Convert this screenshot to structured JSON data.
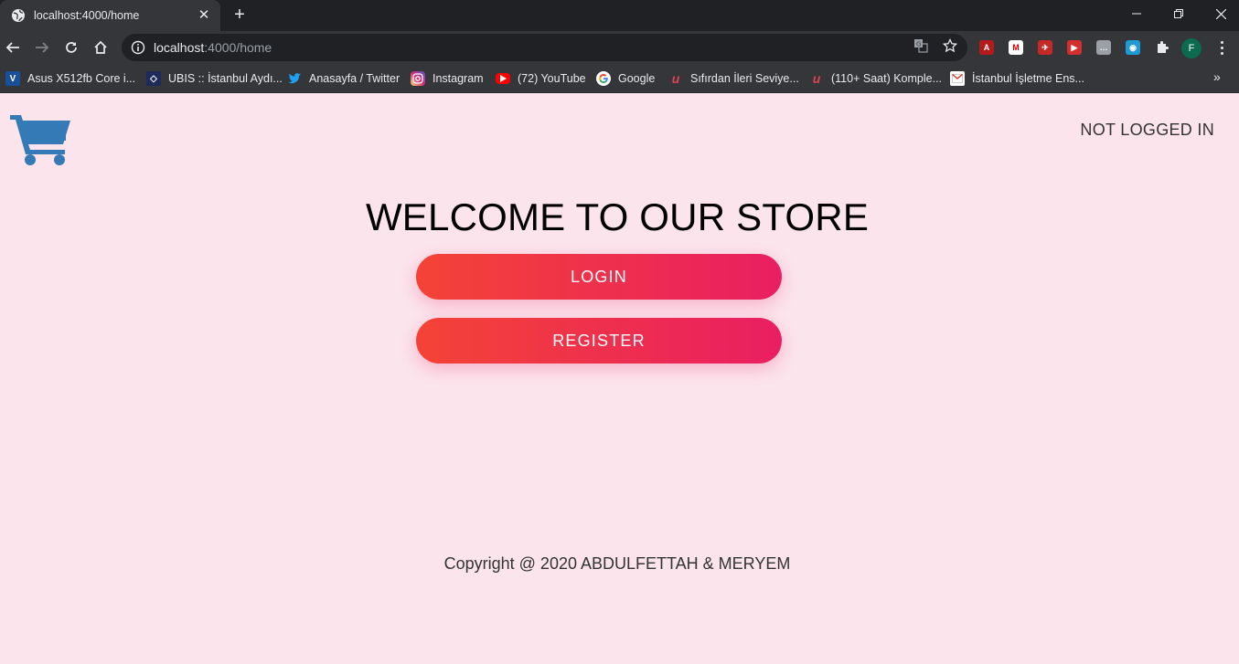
{
  "browser": {
    "tab": {
      "title": "localhost:4000/home"
    },
    "address_bar": {
      "host": "localhost",
      "path": ":4000/home"
    },
    "profile_initial": "F",
    "bookmarks": [
      {
        "label": "Asus X512fb Core i...",
        "icon_text": "V",
        "icon_color": "#1a4f9c"
      },
      {
        "label": "UBIS :: İstanbul Aydı...",
        "icon_text": "◇",
        "icon_color": "#1d2a5c"
      },
      {
        "label": "Anasayfa / Twitter",
        "icon_text": "🐦",
        "icon_color": "#1da1f2"
      },
      {
        "label": "Instagram",
        "icon_text": "◎",
        "icon_color": "#d6249f"
      },
      {
        "label": "(72) YouTube",
        "icon_text": "▶",
        "icon_color": "#ff0000"
      },
      {
        "label": "Google",
        "icon_text": "G",
        "icon_color": "#ffffff"
      },
      {
        "label": "Sıfırdan İleri Seviye...",
        "icon_text": "u",
        "icon_color": "#e0414f"
      },
      {
        "label": "(110+ Saat) Komple...",
        "icon_text": "u",
        "icon_color": "#e0414f"
      },
      {
        "label": "İstanbul İşletme Ens...",
        "icon_text": "G",
        "icon_color": "#ffffff"
      }
    ],
    "bookmarks_overflow": "»"
  },
  "page": {
    "login_status": "NOT LOGGED IN",
    "welcome_title": "WELCOME TO OUR STORE",
    "login_button": "LOGIN",
    "register_button": "REGISTER",
    "copyright": "Copyright @ 2020 ABDULFETTAH & MERYEM",
    "colors": {
      "background": "#fce4ec",
      "cart_icon": "#337ab7",
      "button_gradient_start": "#f44336",
      "button_gradient_end": "#e91e63"
    }
  }
}
